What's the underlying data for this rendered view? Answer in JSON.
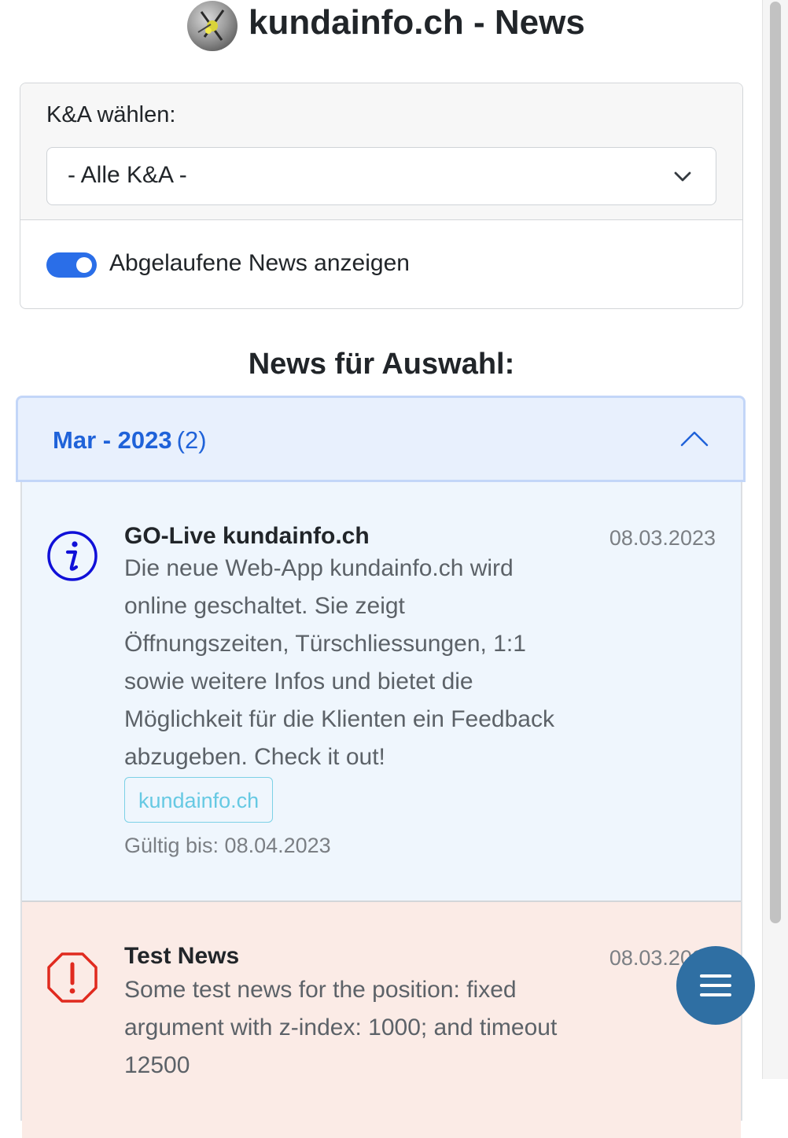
{
  "header": {
    "title": "kundainfo.ch - News"
  },
  "filter": {
    "label": "K&A wählen:",
    "selected": "- Alle K&A -",
    "toggle_label": "Abgelaufene News anzeigen",
    "toggle_on": true
  },
  "section_title": "News für Auswahl:",
  "accordion": {
    "month": "Mar - 2023",
    "count": "(2)",
    "expanded": true
  },
  "news": [
    {
      "type": "info",
      "icon": "info-icon",
      "title": "GO-Live kundainfo.ch",
      "date": "08.03.2023",
      "body_lines": [
        "Die neue Web-App kundainfo.ch wird",
        "online geschaltet. Sie zeigt",
        "Öffnungszeiten, Türschliessungen, 1:1",
        "sowie weitere Infos und bietet die",
        "Möglichkeit für die Klienten ein Feedback",
        "abzugeben. Check it out!"
      ],
      "link_label": "kundainfo.ch",
      "valid_until": "Gültig bis: 08.04.2023"
    },
    {
      "type": "danger",
      "icon": "warning-octagon-icon",
      "title": "Test News",
      "date": "08.03.2023",
      "body_lines": [
        "Some test news for the position: fixed",
        "argument with z-index: 1000; and timeout",
        "12500"
      ]
    }
  ],
  "fab": {
    "icon": "hamburger-menu-icon"
  },
  "colors": {
    "accent": "#2a6ee8",
    "accordion_text": "#1f62d9",
    "info_bg": "#eff6fd",
    "danger_bg": "#fbebe6",
    "fab": "#2f6fa3"
  }
}
